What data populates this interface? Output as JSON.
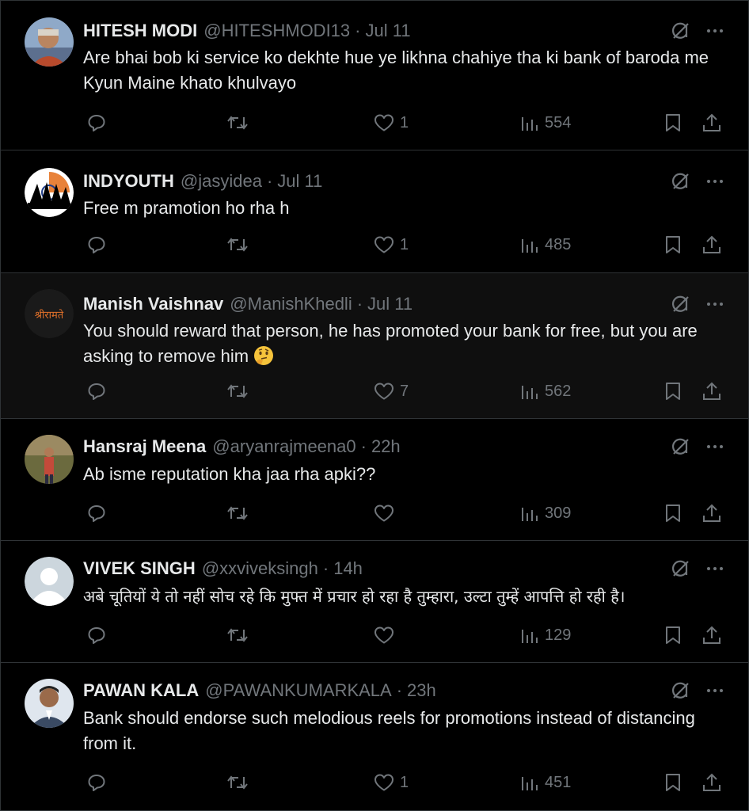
{
  "tweets": [
    {
      "name": "HITESH MODI",
      "handle": "@HITESHMODI13",
      "time": "Jul 11",
      "text": "Are bhai bob ki service ko dekhte hue ye likhna chahiye tha ki bank of baroda me Kyun Maine khato khulvayo",
      "likes": "1",
      "views": "554"
    },
    {
      "name": "INDYOUTH",
      "handle": "@jasyidea",
      "time": "Jul 11",
      "text": "Free m pramotion ho rha h",
      "likes": "1",
      "views": "485"
    },
    {
      "name": "Manish Vaishnav",
      "handle": "@ManishKhedli",
      "time": "Jul 11",
      "text": "You should reward that person, he has promoted your bank for free, but you are asking to remove him",
      "emoji": "thinking-face",
      "likes": "7",
      "views": "562"
    },
    {
      "name": "Hansraj Meena",
      "handle": "@aryanrajmeena0",
      "time": "22h",
      "text": "Ab isme reputation kha jaa rha apki??",
      "likes": "",
      "views": "309"
    },
    {
      "name": "VIVEK SINGH",
      "handle": "@xxviveksingh",
      "time": "14h",
      "text": "अबे चूतियों ये तो नहीं सोच रहे कि मुफ्त में प्रचार हो रहा है तुम्हारा, उल्टा तुम्हें आपत्ति  हो रही है।",
      "likes": "",
      "views": "129"
    },
    {
      "name": "PAWAN KALA",
      "handle": "@PAWANKUMARKALA",
      "time": "23h",
      "text": "Bank should endorse such melodious reels for promotions instead of distancing from it.",
      "likes": "1",
      "views": "451"
    }
  ],
  "separator": "·",
  "avatar_logo_text": "श्रीरामते",
  "icons": {
    "reply": "reply-icon",
    "retweet": "retweet-icon",
    "like": "heart-icon",
    "views": "views-icon",
    "bookmark": "bookmark-icon",
    "share": "share-icon",
    "grok": "grok-icon",
    "more": "more-icon"
  },
  "colors": {
    "background": "#000000",
    "highlight_background": "#0f0f0f",
    "text": "#e7e9ea",
    "secondary": "#71767b",
    "border": "#2f3336"
  }
}
